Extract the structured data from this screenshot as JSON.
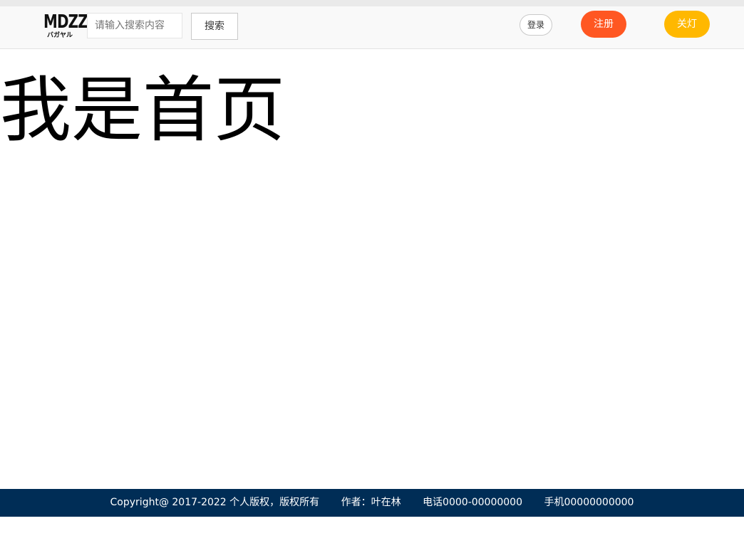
{
  "header": {
    "logo": {
      "main": "MDZZ",
      "sub": "バガヤル"
    },
    "search": {
      "placeholder": "请输入搜索内容",
      "value": ""
    },
    "search_button": "搜索",
    "login_button": "登录",
    "register_button": "注册",
    "lights_button": "关灯"
  },
  "main": {
    "title": "我是首页"
  },
  "footer": {
    "copyright": "Copyright@ 2017-2022 个人版权，版权所有",
    "author": "作者：叶在林",
    "phone": "电话0000-00000000",
    "mobile": "手机00000000000"
  },
  "colors": {
    "footer_bg": "#002d56",
    "register_bg": "#ff5722",
    "lights_bg": "#ffb800"
  }
}
